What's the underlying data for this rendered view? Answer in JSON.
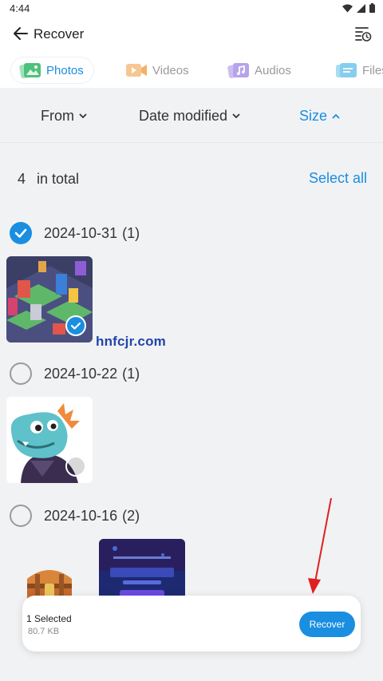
{
  "status_bar": {
    "time": "4:44"
  },
  "app_bar": {
    "title": "Recover"
  },
  "tabs": [
    {
      "label": "Photos",
      "active": true,
      "icon": "photo-icon"
    },
    {
      "label": "Videos",
      "active": false,
      "icon": "video-icon"
    },
    {
      "label": "Audios",
      "active": false,
      "icon": "music-icon"
    },
    {
      "label": "Files",
      "active": false,
      "icon": "file-icon"
    }
  ],
  "sort": {
    "from": "From",
    "date_modified": "Date modified",
    "size": "Size"
  },
  "summary": {
    "count": "4",
    "label": "in total",
    "select_all": "Select all"
  },
  "groups": [
    {
      "date": "2024-10-31",
      "count": "(1)",
      "checked": true
    },
    {
      "date": "2024-10-22",
      "count": "(1)",
      "checked": false
    },
    {
      "date": "2024-10-16",
      "count": "(2)",
      "checked": false
    }
  ],
  "watermark": "hnfcjr.com",
  "bottom_bar": {
    "selected": "1 Selected",
    "size": "80.7 KB",
    "recover_label": "Recover"
  },
  "colors": {
    "accent": "#1a8ee0",
    "annotation_arrow": "#e02020"
  }
}
